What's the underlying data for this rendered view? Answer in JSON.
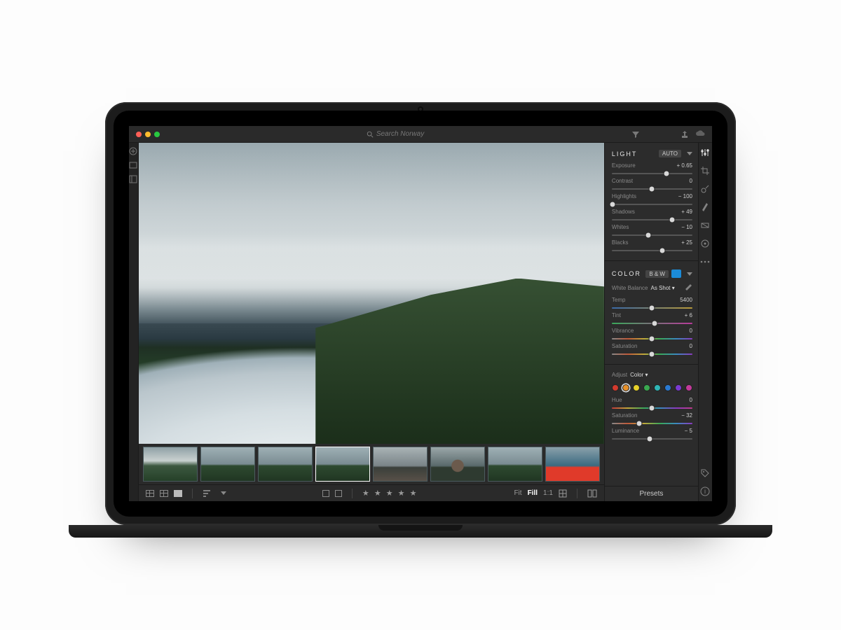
{
  "search": {
    "placeholder": "Search Norway"
  },
  "light": {
    "title": "LIGHT",
    "auto": "AUTO",
    "exposure": {
      "label": "Exposure",
      "value": "+ 0.65",
      "pos": 68
    },
    "contrast": {
      "label": "Contrast",
      "value": "0",
      "pos": 50
    },
    "highlights": {
      "label": "Highlights",
      "value": "− 100",
      "pos": 1
    },
    "shadows": {
      "label": "Shadows",
      "value": "+ 49",
      "pos": 75
    },
    "whites": {
      "label": "Whites",
      "value": "− 10",
      "pos": 45
    },
    "blacks": {
      "label": "Blacks",
      "value": "+ 25",
      "pos": 63
    }
  },
  "color": {
    "title": "COLOR",
    "bw": "B & W",
    "wb_label": "White Balance",
    "wb_value": "As Shot",
    "temp": {
      "label": "Temp",
      "value": "5400",
      "pos": 50
    },
    "tint": {
      "label": "Tint",
      "value": "+ 6",
      "pos": 53
    },
    "vibrance": {
      "label": "Vibrance",
      "value": "0",
      "pos": 50
    },
    "saturation": {
      "label": "Saturation",
      "value": "0",
      "pos": 50
    }
  },
  "mixer": {
    "adjust_label": "Adjust",
    "adjust_value": "Color",
    "swatches": [
      "#d23a2e",
      "#e6902a",
      "#e6d02a",
      "#3aa850",
      "#2fb5b5",
      "#2a7ad2",
      "#7a3ad2",
      "#c23a9a"
    ],
    "selected": 1,
    "hue": {
      "label": "Hue",
      "value": "0",
      "pos": 50
    },
    "saturation": {
      "label": "Saturation",
      "value": "− 32",
      "pos": 34
    },
    "luminance": {
      "label": "Luminance",
      "value": "− 5",
      "pos": 47
    }
  },
  "presets_label": "Presets",
  "zoom": {
    "fit": "Fit",
    "fill": "Fill",
    "one": "1:1"
  },
  "thumbs": [
    {
      "cls": "th-sky"
    },
    {
      "cls": "th-mtn"
    },
    {
      "cls": "th-mtn"
    },
    {
      "cls": "th-mtn",
      "sel": true
    },
    {
      "cls": "th-road"
    },
    {
      "cls": "th-person"
    },
    {
      "cls": "th-mtn"
    },
    {
      "cls": "th-kayak"
    }
  ],
  "stars": "★ ★ ★ ★ ★"
}
